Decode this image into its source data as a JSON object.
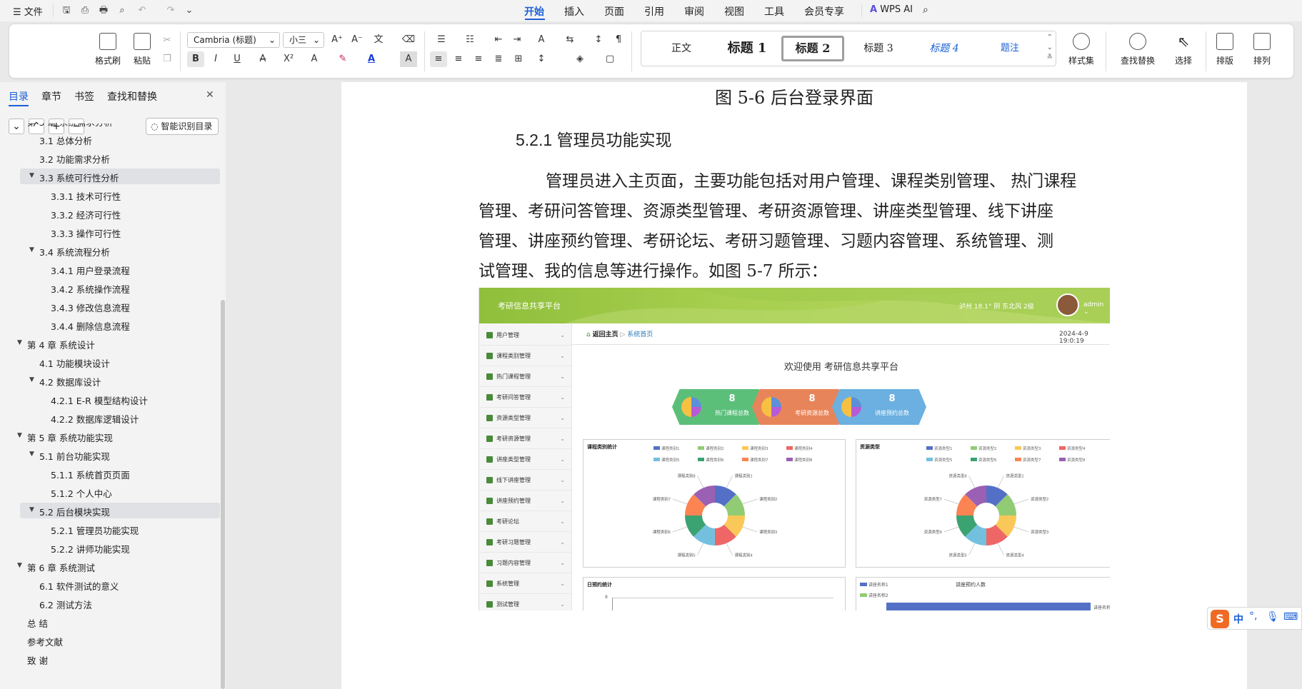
{
  "menu": {
    "file_label": "文件"
  },
  "tabs": [
    "开始",
    "插入",
    "页面",
    "引用",
    "审阅",
    "视图",
    "工具",
    "会员专享"
  ],
  "wps_ai": "WPS AI",
  "ribbon": {
    "format_painter": "格式刷",
    "paste": "粘贴",
    "font_name": "Cambria (标题)",
    "font_size": "小三",
    "styles": [
      "正文",
      "标题 1",
      "标题 2",
      "标题 3",
      "标题 4",
      "题注"
    ],
    "style_set": "样式集",
    "find_replace": "查找替换",
    "select": "选择",
    "layout": "排版",
    "arrange": "排列"
  },
  "sidebar": {
    "tabs": [
      "目录",
      "章节",
      "书签",
      "查找和替换"
    ],
    "smart_toc": "智能识别目录",
    "toc": [
      {
        "label": "第 3 章  系统需求分析",
        "level": 1
      },
      {
        "label": "3.1 总体分析",
        "level": 2
      },
      {
        "label": "3.2 功能需求分析",
        "level": 2
      },
      {
        "label": "3.3  系统可行性分析",
        "level": 2
      },
      {
        "label": "3.3.1 技术可行性",
        "level": 3
      },
      {
        "label": "3.3.2 经济可行性",
        "level": 3
      },
      {
        "label": "3.3.3 操作可行性",
        "level": 3
      },
      {
        "label": "3.4 系统流程分析",
        "level": 2
      },
      {
        "label": "3.4.1  用户登录流程",
        "level": 3
      },
      {
        "label": "3.4.2  系统操作流程",
        "level": 3
      },
      {
        "label": "3.4.3 修改信息流程",
        "level": 3
      },
      {
        "label": "3.4.4 删除信息流程",
        "level": 3
      },
      {
        "label": "第 4 章  系统设计",
        "level": 1
      },
      {
        "label": "4.1  功能模块设计",
        "level": 2
      },
      {
        "label": "4.2  数据库设计",
        "level": 2
      },
      {
        "label": "4.2.1 E-R 模型结构设计",
        "level": 3
      },
      {
        "label": "4.2.2  数据库逻辑设计",
        "level": 3
      },
      {
        "label": "第 5 章  系统功能实现",
        "level": 1
      },
      {
        "label": "5.1 前台功能实现",
        "level": 2
      },
      {
        "label": "5.1.1 系统首页页面",
        "level": 3
      },
      {
        "label": "5.1.2 个人中心",
        "level": 3
      },
      {
        "label": "5.2 后台模块实现",
        "level": 2
      },
      {
        "label": "5.2.1 管理员功能实现",
        "level": 3
      },
      {
        "label": "5.2.2 讲师功能实现",
        "level": 3
      },
      {
        "label": "第 6 章  系统测试",
        "level": 1
      },
      {
        "label": "6.1  软件测试的意义",
        "level": 2
      },
      {
        "label": "6.2  测试方法",
        "level": 2
      },
      {
        "label": "总  结",
        "level": 1
      },
      {
        "label": "参考文献",
        "level": 1
      },
      {
        "label": "致  谢",
        "level": 1
      }
    ]
  },
  "document": {
    "caption": "图 5-6 后台登录界面",
    "heading": "5.2.1 管理员功能实现",
    "lines": [
      "管理员进入主页面，主要功能包括对用户管理、课程类别管理、  热门课程",
      "管理、考研问答管理、资源类型管理、考研资源管理、讲座类型管理、线下讲座",
      "管理、讲座预约管理、考研论坛、考研习题管理、习题内容管理、系统管理、测",
      "试管理、我的信息等进行操作。如图 5-7 所示："
    ]
  },
  "figure": {
    "platform": "考研信息共享平台",
    "weather": "泸州 18.1° 阴 东北风 2级",
    "user": "admin",
    "breadcrumb_home": "返回主页",
    "breadcrumb_sep": "▷",
    "breadcrumb_page": "系统首页",
    "datetime": "2024-4-9 19:0:19",
    "welcome": "欢迎使用 考研信息共享平台",
    "menu": [
      "用户管理",
      "课程类别管理",
      "热门课程管理",
      "考研问答管理",
      "资源类型管理",
      "考研资源管理",
      "讲座类型管理",
      "线下讲座管理",
      "讲座预约管理",
      "考研论坛",
      "考研习题管理",
      "习题内容管理",
      "系统管理",
      "测试管理"
    ],
    "stats": [
      {
        "value": "8",
        "label": "热门课程总数",
        "color": "#5bbf7a"
      },
      {
        "value": "8",
        "label": "考研资源总数",
        "color": "#e8845a"
      },
      {
        "value": "8",
        "label": "讲座预约总数",
        "color": "#6bb0e0"
      }
    ],
    "panel1_title": "课程类别统计",
    "panel1_legend": [
      "课程类别1",
      "课程类别2",
      "课程类别3",
      "课程类别4",
      "课程类别5",
      "课程类别6",
      "课程类别7",
      "课程类别8"
    ],
    "panel2_title": "资源类型",
    "panel2_legend": [
      "资源类型1",
      "资源类型2",
      "资源类型3",
      "资源类型4",
      "资源类型5",
      "资源类型6",
      "资源类型7",
      "资源类型8"
    ],
    "panel3_title": "日预约统计",
    "panel3_axis": "8",
    "panel4_title": "讲座预约人数",
    "panel4_legend": [
      "讲座名称1",
      "讲座名称2"
    ],
    "panel4_bar_label": "讲座名称",
    "slice_colors": [
      "#5470c6",
      "#91cc75",
      "#fac858",
      "#ee6666",
      "#73c0de",
      "#3ba272",
      "#fc8452",
      "#9a60b4"
    ]
  },
  "ime": {
    "lang": "中"
  }
}
